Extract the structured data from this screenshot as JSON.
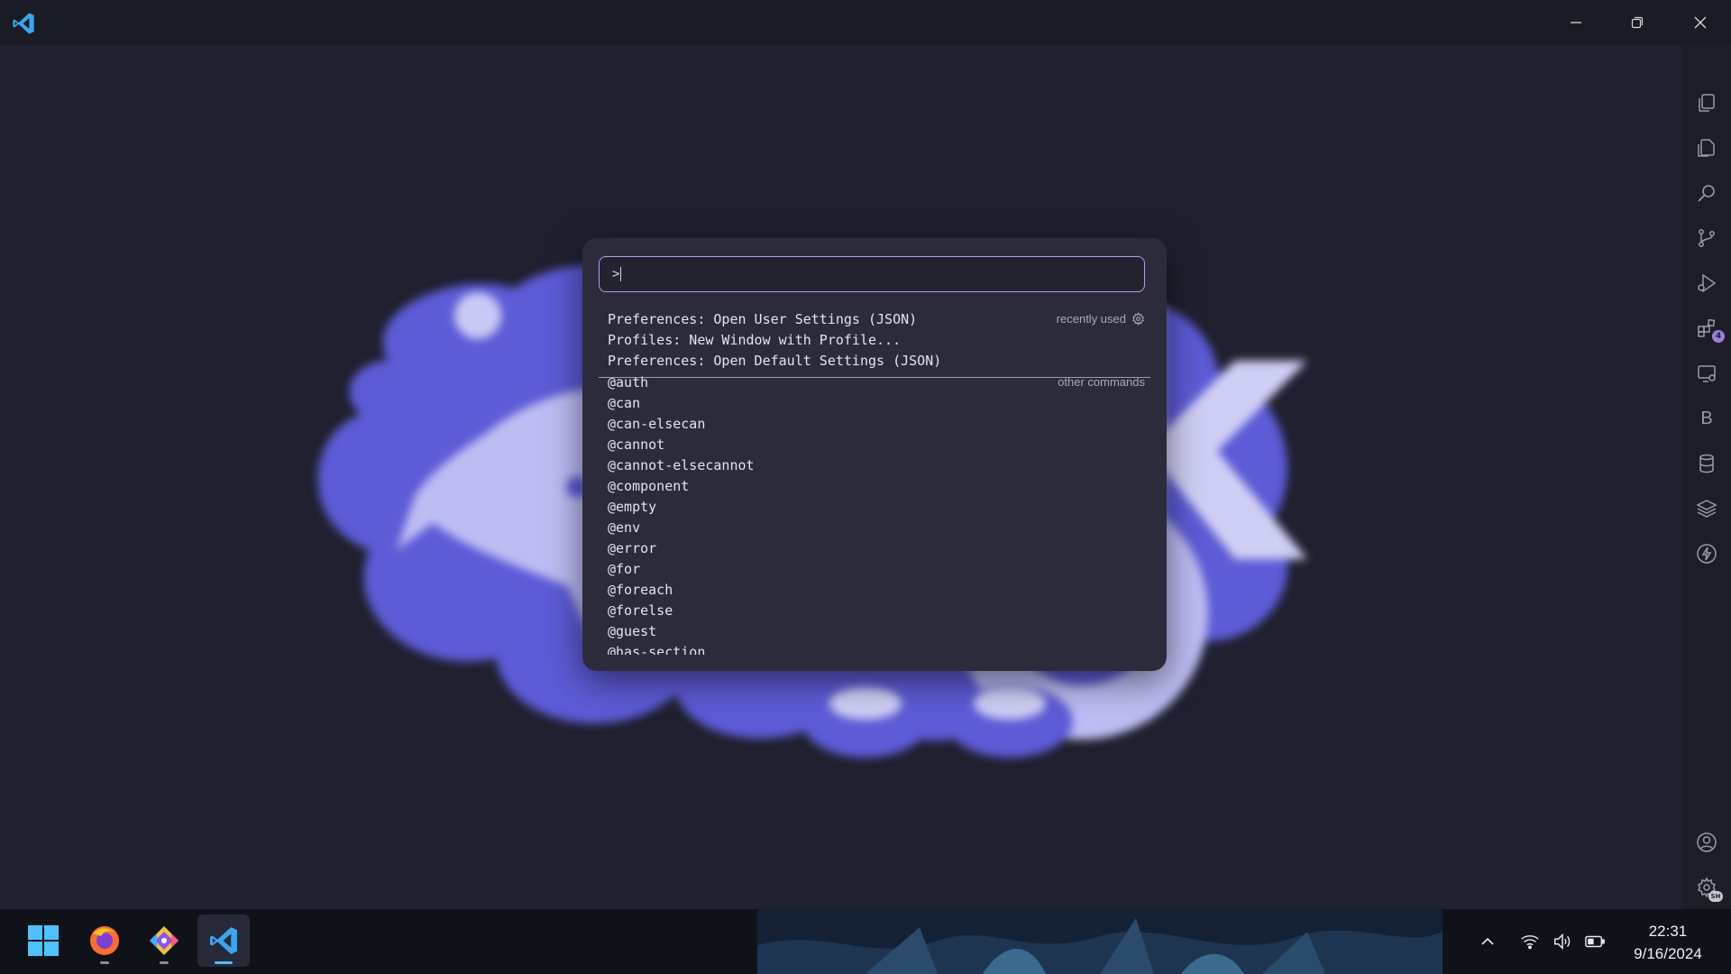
{
  "window": {
    "icons": {
      "app": "vscode-icon",
      "minimize": "minimize-icon",
      "restore": "restore-icon",
      "close": "close-icon"
    }
  },
  "activity_bar": {
    "items": [
      {
        "icon": "copy-icon"
      },
      {
        "icon": "explorer-icon"
      },
      {
        "icon": "search-icon"
      },
      {
        "icon": "source-control-icon"
      },
      {
        "icon": "run-debug-icon"
      },
      {
        "icon": "extensions-icon",
        "badge": "4"
      },
      {
        "icon": "remote-explorer-icon"
      },
      {
        "icon": "b-extension-icon",
        "label": "B"
      },
      {
        "icon": "database-icon"
      },
      {
        "icon": "layers-icon"
      },
      {
        "icon": "lightning-icon"
      }
    ],
    "bottom": [
      {
        "icon": "account-icon"
      },
      {
        "icon": "manage-gear-icon",
        "badge": "SH"
      }
    ]
  },
  "command_palette": {
    "input_value": ">",
    "recently_used": {
      "hint": "recently used",
      "items": [
        "Preferences: Open User Settings (JSON)",
        "Profiles: New Window with Profile...",
        "Preferences: Open Default Settings (JSON)"
      ]
    },
    "other_commands": {
      "hint": "other commands",
      "items": [
        "@auth",
        "@can",
        "@can-elsecan",
        "@cannot",
        "@cannot-elsecannot",
        "@component",
        "@empty",
        "@env",
        "@error",
        "@for",
        "@foreach",
        "@forelse",
        "@guest",
        "@has-section"
      ]
    }
  },
  "taskbar": {
    "apps": [
      {
        "icon": "windows-start-icon"
      },
      {
        "icon": "firefox-icon",
        "running": true
      },
      {
        "icon": "git-app-icon",
        "running": true
      },
      {
        "icon": "vscode-icon",
        "active": true
      }
    ],
    "tray": [
      "chevron-up-icon",
      "wifi-icon",
      "volume-icon",
      "battery-icon"
    ],
    "time": "22:31",
    "date": "9/16/2024"
  },
  "colors": {
    "accent": "#b39de8",
    "background": "#1f2030",
    "palette_bg": "#2b2b3c",
    "mascot": "#5d5bd6"
  }
}
